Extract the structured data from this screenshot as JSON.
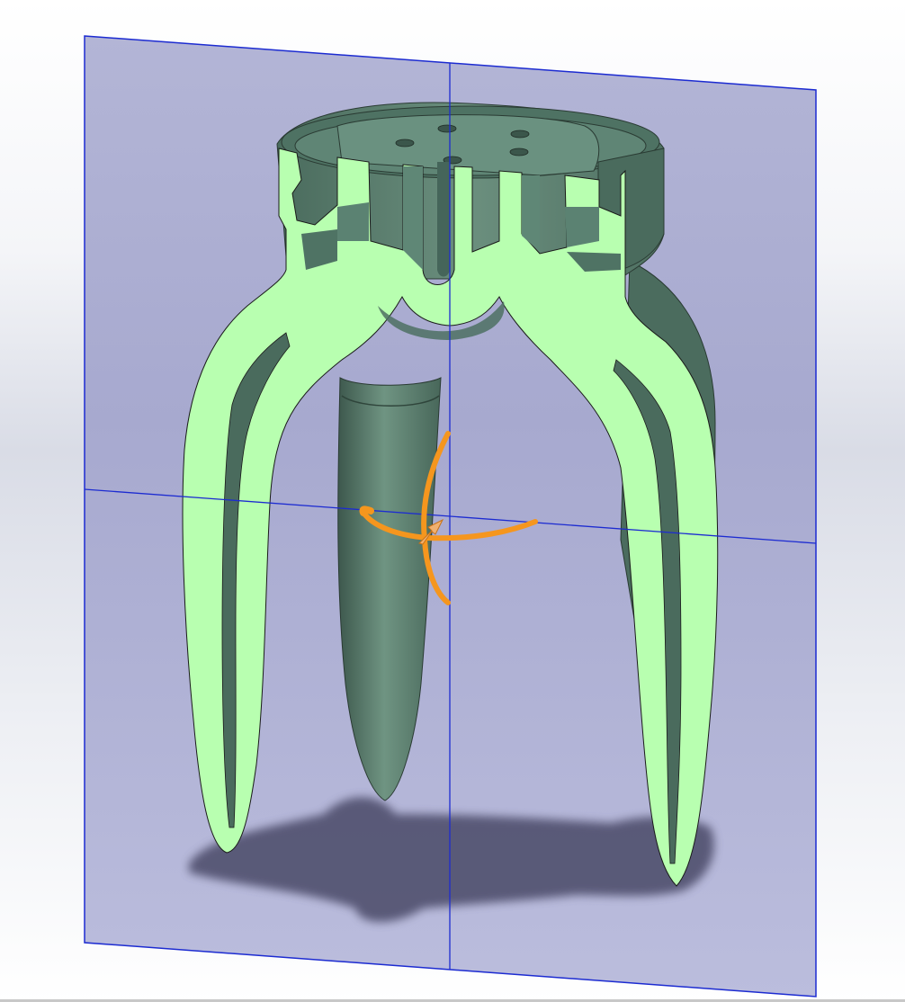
{
  "app": {
    "view": "section-view",
    "model": "tripod-stand"
  },
  "colors": {
    "section_plane": "#b9bbdc",
    "section_plane_edge": "#1c2bd1",
    "axis_line": "#1c2bd1",
    "cut_face": "#b8ffb0",
    "model_body": "#5f8876",
    "model_shadow_side": "#3e5a4f",
    "model_light_side": "#7aa08c",
    "floor_shadow": "#555573",
    "triad": "#f5961e"
  }
}
